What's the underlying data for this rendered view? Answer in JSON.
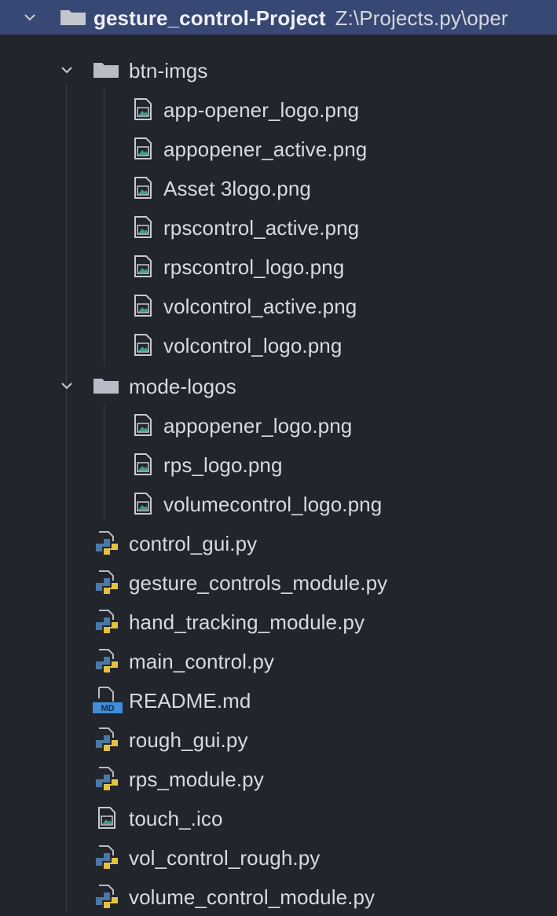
{
  "root": {
    "name": "gesture_control-Project",
    "path": "Z:\\Projects.py\\oper"
  },
  "folders": [
    {
      "name": "btn-imgs",
      "files": [
        "app-opener_logo.png",
        "appopener_active.png",
        "Asset 3logo.png",
        "rpscontrol_active.png",
        "rpscontrol_logo.png",
        "volcontrol_active.png",
        "volcontrol_logo.png"
      ]
    },
    {
      "name": "mode-logos",
      "files": [
        "appopener_logo.png",
        "rps_logo.png",
        "volumecontrol_logo.png"
      ]
    }
  ],
  "root_files": [
    {
      "name": "control_gui.py",
      "icon": "python-file-icon"
    },
    {
      "name": "gesture_controls_module.py",
      "icon": "python-file-icon"
    },
    {
      "name": "hand_tracking_module.py",
      "icon": "python-file-icon"
    },
    {
      "name": "main_control.py",
      "icon": "python-file-icon"
    },
    {
      "name": "README.md",
      "icon": "markdown-file-icon"
    },
    {
      "name": "rough_gui.py",
      "icon": "python-file-icon"
    },
    {
      "name": "rps_module.py",
      "icon": "python-file-icon"
    },
    {
      "name": "touch_.ico",
      "icon": "image-file-icon"
    },
    {
      "name": "vol_control_rough.py",
      "icon": "python-file-icon"
    },
    {
      "name": "volume_control_module.py",
      "icon": "python-file-icon"
    }
  ],
  "colors": {
    "background": "#23252d",
    "selection": "#384874",
    "folder": "#b9bcc6",
    "python_blue": "#4a78a8",
    "python_yellow": "#e3c23f",
    "markdown_blue": "#3f8ddb"
  }
}
